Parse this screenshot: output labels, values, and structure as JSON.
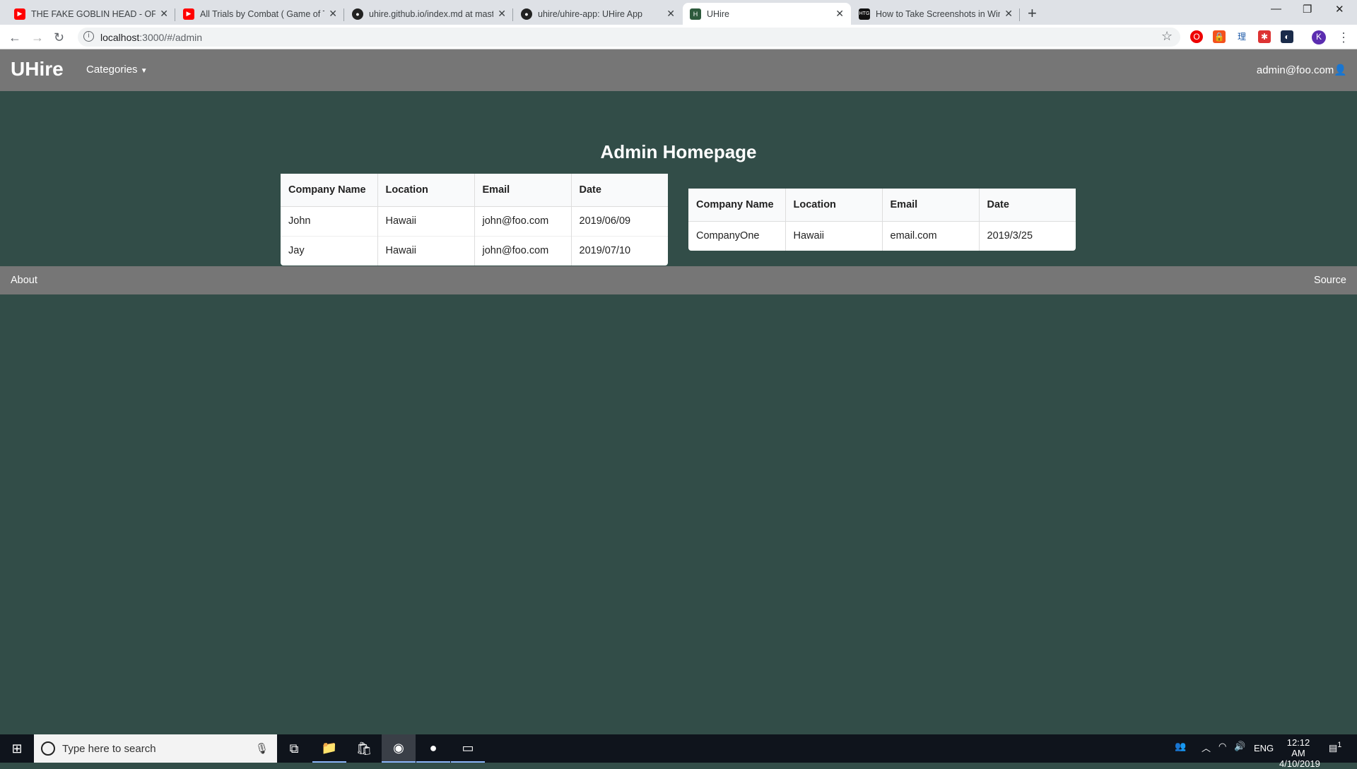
{
  "browser": {
    "tabs": [
      {
        "title": "THE FAKE GOBLIN HEAD - OFFLINE",
        "icon": "youtube-icon",
        "active": false
      },
      {
        "title": "All Trials by Combat ( Game of Thrones",
        "icon": "youtube-icon",
        "active": false
      },
      {
        "title": "uhire.github.io/index.md at master",
        "icon": "github-icon",
        "active": false
      },
      {
        "title": "uhire/uhire-app: UHire App",
        "icon": "github-icon",
        "active": false
      },
      {
        "title": "UHire",
        "icon": "uhire-icon",
        "active": true
      },
      {
        "title": "How to Take Screenshots in Windows",
        "icon": "htg-icon",
        "active": false
      }
    ],
    "url_host": "localhost",
    "url_path": ":3000/#/admin",
    "profile_initial": "K",
    "ext_label": "理"
  },
  "navbar": {
    "brand": "UHire",
    "categories": "Categories",
    "user": "admin@foo.com"
  },
  "main": {
    "title": "Admin Homepage",
    "table1": {
      "headers": [
        "Company Name",
        "Location",
        "Email",
        "Date"
      ],
      "rows": [
        [
          "John",
          "Hawaii",
          "john@foo.com",
          "2019/06/09"
        ],
        [
          "Jay",
          "Hawaii",
          "john@foo.com",
          "2019/07/10"
        ]
      ]
    },
    "table2": {
      "headers": [
        "Company Name",
        "Location",
        "Email",
        "Date"
      ],
      "rows": [
        [
          "CompanyOne",
          "Hawaii",
          "email.com",
          "2019/3/25"
        ]
      ]
    }
  },
  "footer": {
    "about": "About",
    "source": "Source"
  },
  "taskbar": {
    "search_placeholder": "Type here to search",
    "time": "12:12 AM",
    "date": "4/10/2019",
    "lang": "ENG",
    "notifications": "1"
  },
  "colors": {
    "navbar": "#767676",
    "background": "#324d48"
  }
}
